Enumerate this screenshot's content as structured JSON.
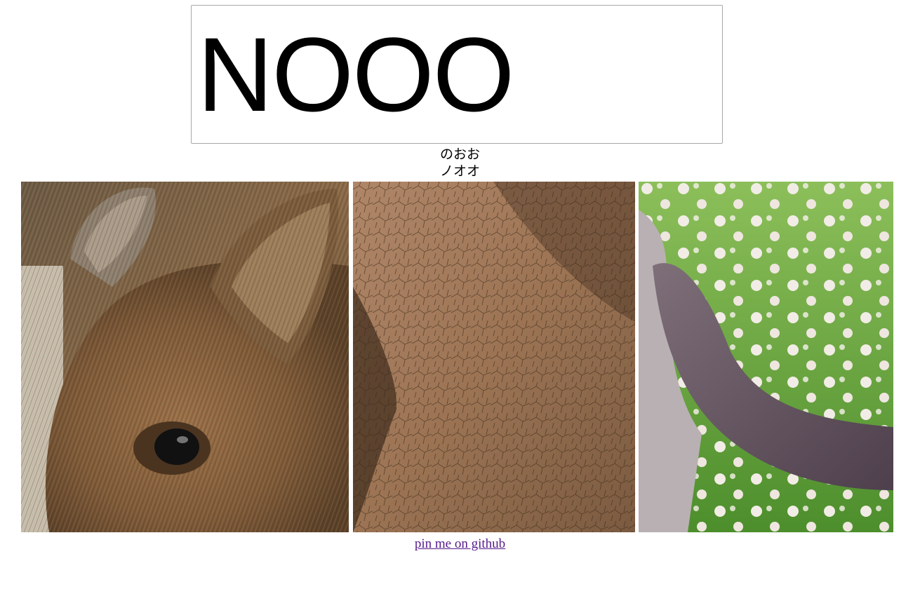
{
  "input": {
    "value": "NOOO"
  },
  "readings": {
    "hiragana": "のおお",
    "katakana": "ノオオ"
  },
  "panels": [
    {
      "icon": "boar-photo"
    },
    {
      "icon": "elephant-photo"
    },
    {
      "icon": "cat-photo"
    }
  ],
  "footer": {
    "link_text": "pin me on github",
    "link_color": "#551a8b"
  }
}
